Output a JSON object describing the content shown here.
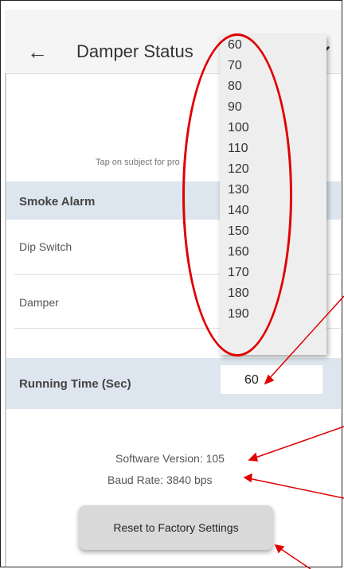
{
  "header": {
    "back_icon": "arrow-left-icon",
    "title": "Damper Status",
    "refresh_icon": "refresh-icon"
  },
  "instructions": "Tap on subject for pro",
  "smoke_alarm": {
    "section_title": "Smoke Alarm",
    "rows": [
      "Dip Switch",
      "Damper"
    ]
  },
  "running_time": {
    "label": "Running Time (Sec)",
    "value": "60",
    "options": [
      "60",
      "70",
      "80",
      "90",
      "100",
      "110",
      "120",
      "130",
      "140",
      "150",
      "160",
      "170",
      "180",
      "190"
    ]
  },
  "info": {
    "software_version": "Software Version: 105",
    "baud_rate": "Baud Rate: 3840 bps"
  },
  "reset_button": "Reset to Factory Settings",
  "annotation_color": "#e00000"
}
